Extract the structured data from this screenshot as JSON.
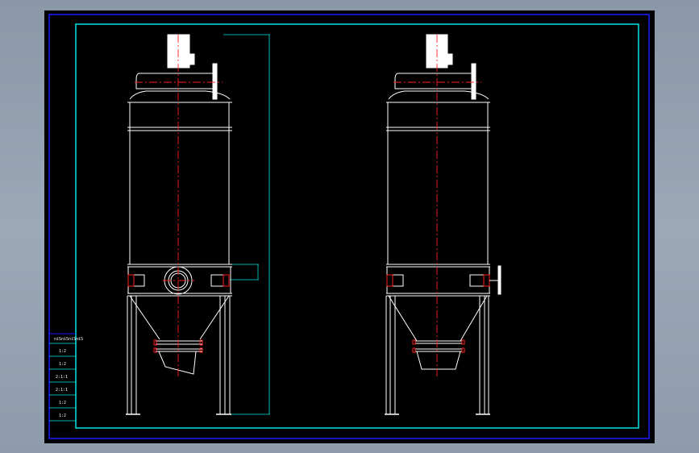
{
  "drawing": {
    "title_block_rows": [
      "пїЅпїЅпїЅпїЅ",
      "1:2",
      "1:2",
      "2:1:1",
      "2:1:1",
      "1:2",
      "1:2"
    ]
  },
  "colors": {
    "background": "#000000",
    "frame_outer": "#1a1aff",
    "frame_inner": "#00e5e5",
    "outline": "#ffffff",
    "centerline": "#ff2020",
    "dimension": "#00e5e5",
    "motor": "#ffffff"
  },
  "icons": {
    "motor": "motor-icon",
    "flange": "flange-icon",
    "inlet_port": "inlet-port-icon"
  }
}
